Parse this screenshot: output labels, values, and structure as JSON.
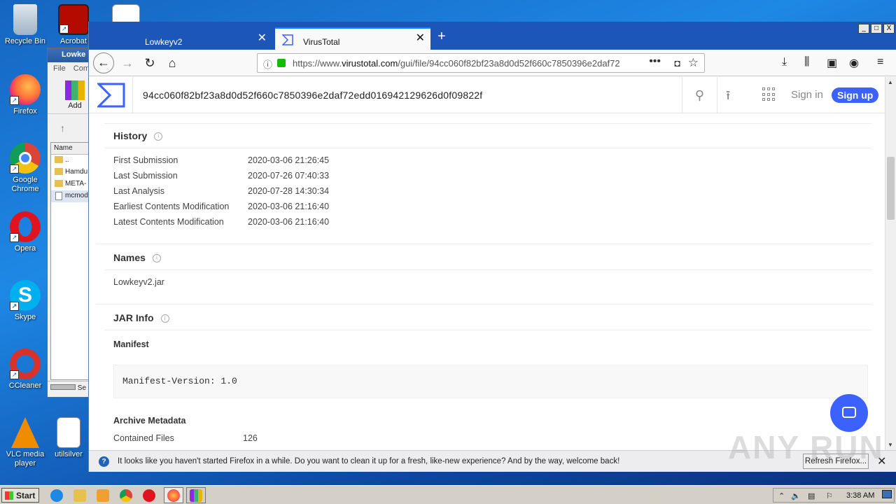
{
  "desktop": {
    "icons": [
      {
        "label": "Recycle Bin"
      },
      {
        "label": "Acrobat"
      },
      {
        "label": "Firefox"
      },
      {
        "label": "Google Chrome"
      },
      {
        "label": "Opera"
      },
      {
        "label": "Skype"
      },
      {
        "label": "CCleaner"
      },
      {
        "label": "VLC media player"
      },
      {
        "label": "utilsilver"
      }
    ]
  },
  "winrar": {
    "title": "Lowke",
    "menu_file": "File",
    "menu_commands": "Com",
    "add_label": "Add",
    "column_name": "Name",
    "files": [
      "..",
      "Hamdu",
      "META-",
      "mcmod"
    ],
    "status": "Se"
  },
  "browser": {
    "tabs": [
      {
        "title": "Lowkeyv2"
      },
      {
        "title": "VirusTotal"
      }
    ],
    "url_prefix": "https://www.",
    "url_domain": "virustotal.com",
    "url_rest": "/gui/file/94cc060f82bf23a8d0d52f660c7850396e2daf72",
    "window_controls": [
      "_",
      "□",
      "X"
    ]
  },
  "vt": {
    "hash": "94cc060f82bf23a8d0d52f660c7850396e2daf72edd016942129626d0f09822f",
    "sign_in": "Sign in",
    "sign_up": "Sign up",
    "history": {
      "title": "History",
      "rows": [
        {
          "key": "First Submission",
          "value": "2020-03-06 21:26:45"
        },
        {
          "key": "Last Submission",
          "value": "2020-07-26 07:40:33"
        },
        {
          "key": "Last Analysis",
          "value": "2020-07-28 14:30:34"
        },
        {
          "key": "Earliest Contents Modification",
          "value": "2020-03-06 21:16:40"
        },
        {
          "key": "Latest Contents Modification",
          "value": "2020-03-06 21:16:40"
        }
      ]
    },
    "names": {
      "title": "Names",
      "items": [
        "Lowkeyv2.jar"
      ]
    },
    "jar": {
      "title": "JAR Info",
      "manifest_title": "Manifest",
      "manifest_text": "Manifest-Version: 1.0",
      "archive_title": "Archive Metadata",
      "contained_files_key": "Contained Files",
      "contained_files_value": "126"
    }
  },
  "notification": {
    "message": "It looks like you haven't started Firefox in a while. Do you want to clean it up for a fresh, like-new experience? And by the way, welcome back!",
    "button": "Refresh Firefox..."
  },
  "watermark": "ANY RUN",
  "taskbar": {
    "start": "Start",
    "clock": "3:38 AM"
  },
  "colors": {
    "vt_blue": "#3b61ff",
    "firefox_tabbar": "#1b56b8"
  }
}
